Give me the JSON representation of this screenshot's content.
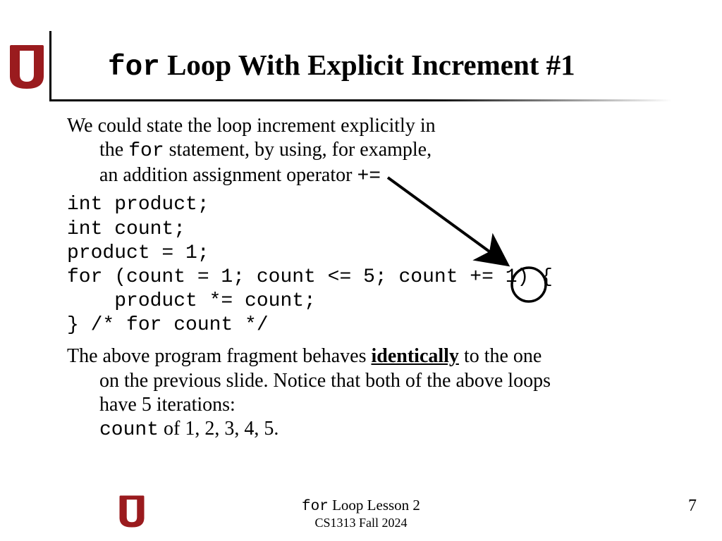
{
  "title": {
    "code": "for",
    "rest": " Loop With Explicit Increment #1"
  },
  "para1": {
    "line1": "We could state the loop increment explicitly in",
    "line2a": "the ",
    "line2code": "for",
    "line2b": " statement, by using, for example,",
    "line3a": "an addition assignment operator  ",
    "line3code": "+="
  },
  "code": "int product;\nint count;\nproduct = 1;\nfor (count = 1; count <= 5; count += 1) {\n    product *= count;\n} /* for count */",
  "para2": {
    "seg1": "The above program fragment behaves ",
    "ident": "identically",
    "seg2": " to the one",
    "line2": "on the previous slide. Notice that both of the above loops",
    "line3": "have 5 iterations:",
    "line4code": "count",
    "line4rest": " of 1, 2, 3, 4, 5."
  },
  "footer": {
    "code": "for",
    "rest": " Loop Lesson 2",
    "sub": "CS1313 Fall 2024"
  },
  "page": "7",
  "logo_color": "#9a1b1e"
}
